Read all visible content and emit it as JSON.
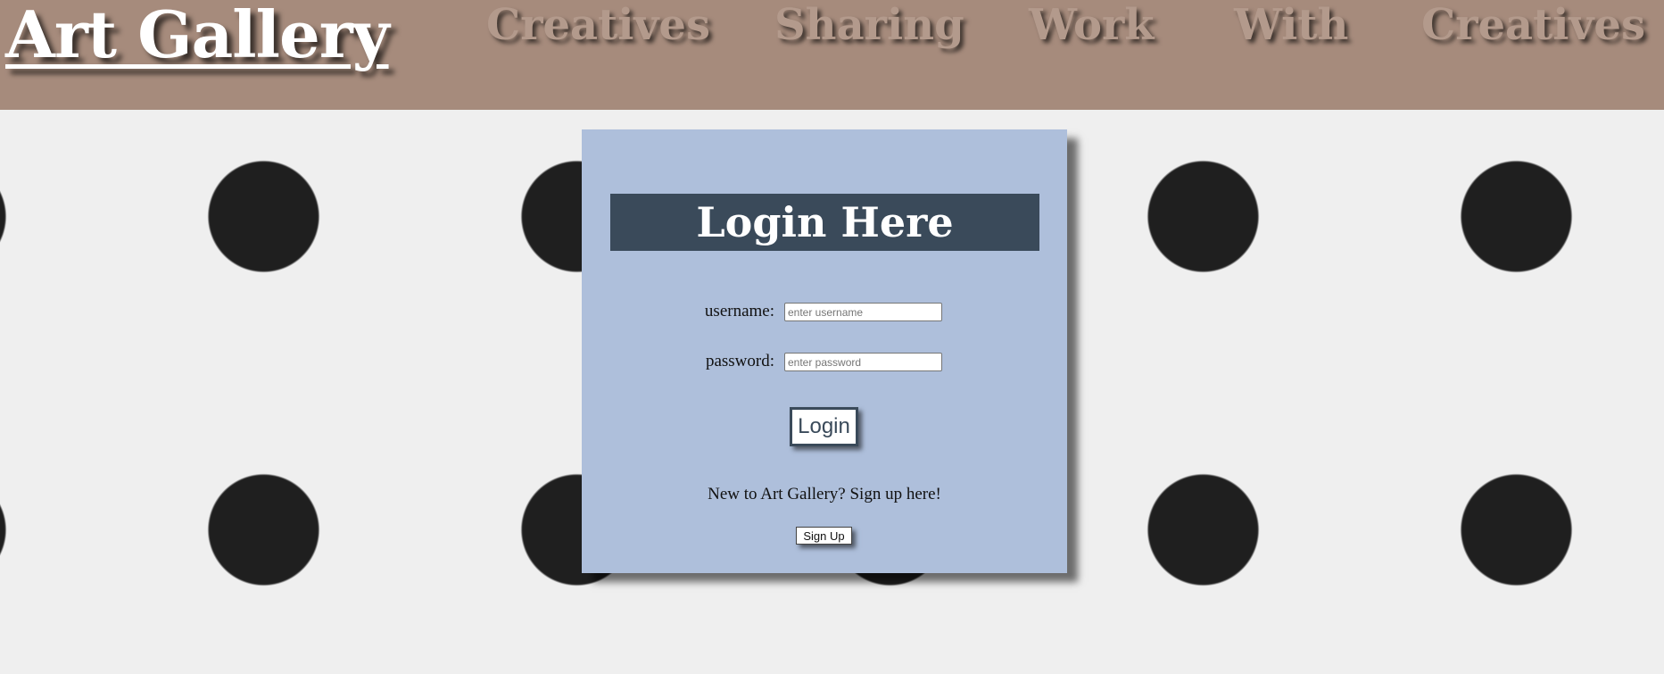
{
  "header": {
    "site_title": "Art Gallery",
    "tagline": [
      "Creatives",
      "Sharing",
      "Work",
      "With",
      "Creatives"
    ]
  },
  "login": {
    "heading": "Login Here",
    "username_label": "username:",
    "username_placeholder": "enter username",
    "password_label": "password:",
    "password_placeholder": "enter password",
    "login_button": "Login",
    "signup_prompt": "New to Art Gallery? Sign up here!",
    "signup_button": "Sign Up"
  },
  "colors": {
    "header_bg": "#a68b7c",
    "card_bg": "#aebfdb",
    "heading_bg": "#3a4a5a",
    "polka_dot": "#1f1f1f",
    "page_bg": "#efefef"
  }
}
